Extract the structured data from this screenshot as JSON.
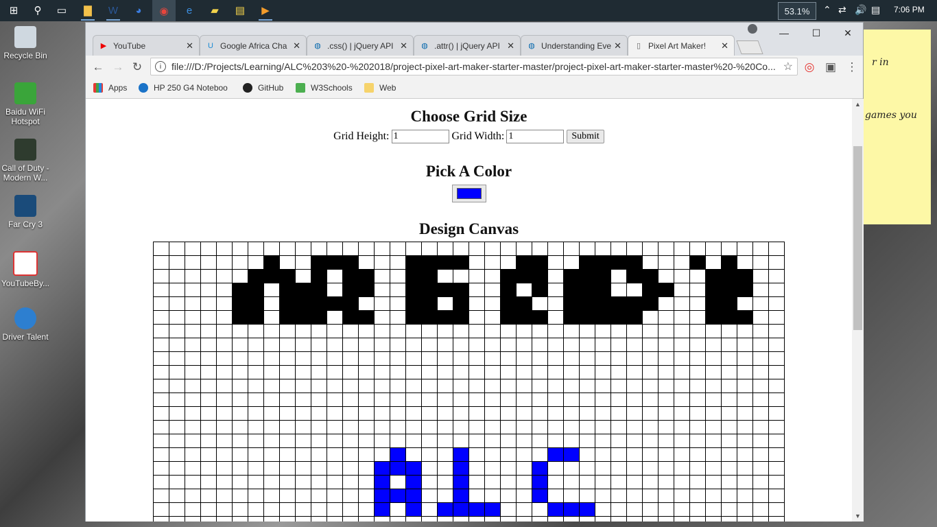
{
  "taskbar": {
    "battery_pct": "53.1%",
    "clock": "7:06 PM"
  },
  "desktop": {
    "icons": [
      {
        "label": "Recycle Bin"
      },
      {
        "label": "Baidu WiFi Hotspot"
      },
      {
        "label": "Call of Duty - Modern W..."
      },
      {
        "label": "Far Cry 3"
      },
      {
        "label": "YouTubeBy..."
      },
      {
        "label": "Driver Talent"
      }
    ]
  },
  "sticky": {
    "line1": "r in",
    "line2": "games you"
  },
  "browser": {
    "tabs": [
      {
        "label": "YouTube",
        "icon": "youtube-icon"
      },
      {
        "label": "Google Africa Cha",
        "icon": "udacity-icon"
      },
      {
        "label": ".css() | jQuery API",
        "icon": "jquery-icon"
      },
      {
        "label": ".attr() | jQuery API",
        "icon": "jquery-icon"
      },
      {
        "label": "Understanding Eve",
        "icon": "jquery-icon"
      },
      {
        "label": "Pixel Art Maker!",
        "icon": "page-icon"
      }
    ],
    "url": "file:///D:/Projects/Learning/ALC%203%20-%202018/project-pixel-art-maker-starter-master/project-pixel-art-maker-starter-master%20-%20Co...",
    "bookmarks": [
      {
        "label": "Apps"
      },
      {
        "label": "HP 250 G4 Noteboo"
      },
      {
        "label": "GitHub"
      },
      {
        "label": "W3Schools"
      },
      {
        "label": "Web"
      }
    ]
  },
  "page": {
    "grid_heading": "Choose Grid Size",
    "height_label": "Grid Height:",
    "height_value": "1",
    "width_label": "Grid Width:",
    "width_value": "1",
    "submit_label": "Submit",
    "color_heading": "Pick A Color",
    "selected_color": "#0000ff",
    "canvas_heading": "Design Canvas"
  },
  "canvas": {
    "columns": 40,
    "visible_rows": 21,
    "colors": {
      "1": "#000000",
      "2": "#0000ff"
    },
    "rows": [
      "0000000000000000000000000000000000000000",
      "0000000100111000111100011001111000101000",
      "0000001110101100110000111011101100011100",
      "0000011011101100111100101011100110011100",
      "0000011011111000110100110011111100011000",
      "0000011011101100111100111011111000011100",
      "0000000000000000000000000000000000000000",
      "0000000000000000000000000000000000000000",
      "0000000000000000000000000000000000000000",
      "0000000000000000000000000000000000000000",
      "0000000000000000000000000000000000000000",
      "0000000000000000000000000000000000000000",
      "0000000000000000000000000000000000000000",
      "0000000000000000000000000000000000000000",
      "0000000000000000000000000000000000000000",
      "0000000000000002000200000220000000000000",
      "0000000000000022200200002000000000000000",
      "0000000000000020200200002000000000000000",
      "0000000000000022200200002000000000000000",
      "0000000000000020202222000222000000000000",
      "0000000000000000000000000000000000000000"
    ]
  }
}
